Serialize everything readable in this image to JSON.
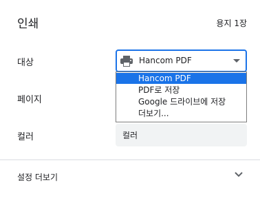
{
  "header": {
    "title": "인쇄",
    "sheet_count": "용지 1장"
  },
  "destination": {
    "label": "대상",
    "selected": "Hancom PDF",
    "icon": "printer-icon",
    "options": [
      {
        "label": "Hancom PDF",
        "selected": true
      },
      {
        "label": "PDF로 저장",
        "selected": false
      },
      {
        "label": "Google 드라이브에 저장",
        "selected": false
      },
      {
        "label": "더보기...",
        "selected": false
      }
    ]
  },
  "pages": {
    "label": "페이지"
  },
  "color": {
    "label": "컬러",
    "selected": "컬러"
  },
  "more_settings": {
    "label": "설정 더보기",
    "icon": "chevron-down-icon"
  },
  "colors": {
    "accent": "#1a73e8",
    "field_bg": "#f1f3f4",
    "divider": "#dadce0",
    "text": "#202124"
  }
}
